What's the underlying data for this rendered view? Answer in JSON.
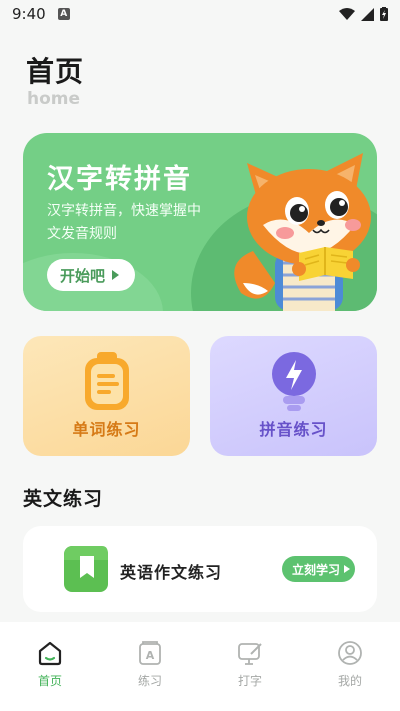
{
  "status_bar": {
    "time": "9:40",
    "notification_icon": "A"
  },
  "header": {
    "title": "首页",
    "subtitle": "home"
  },
  "hero": {
    "title": "汉字转拼音",
    "description": "汉字转拼音，快速掌握中文发音规则",
    "button_label": "开始吧",
    "mascot": "fox-reading-book"
  },
  "cards": [
    {
      "label": "单词练习",
      "icon": "clipboard-icon"
    },
    {
      "label": "拼音练习",
      "icon": "lightbulb-icon"
    }
  ],
  "section": {
    "title": "英文练习",
    "item": {
      "label": "英语作文练习",
      "button_label": "立刻学习",
      "icon": "bookmark-book-icon"
    }
  },
  "tabs": [
    {
      "label": "首页",
      "icon": "home-icon",
      "active": true
    },
    {
      "label": "练习",
      "icon": "practice-icon",
      "active": false
    },
    {
      "label": "打字",
      "icon": "typing-icon",
      "active": false
    },
    {
      "label": "我的",
      "icon": "profile-icon",
      "active": false
    }
  ],
  "colors": {
    "accent": "#5cc26f",
    "hero_bg": "#74cf86",
    "active_tab": "#44b35a"
  }
}
